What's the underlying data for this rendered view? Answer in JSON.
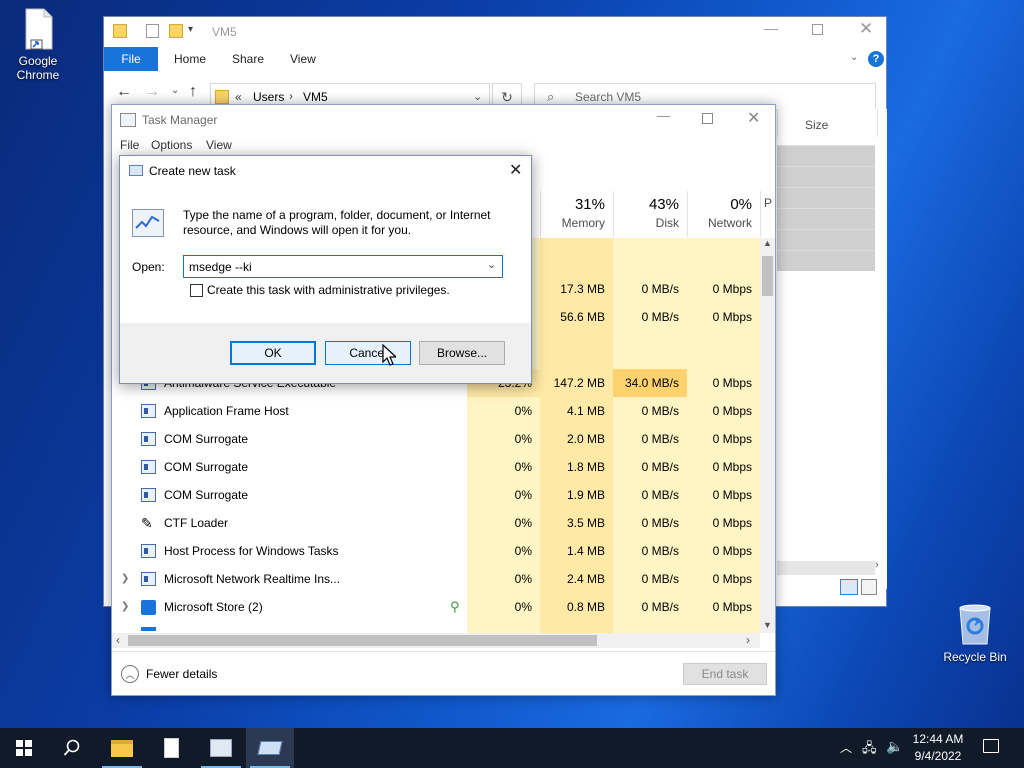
{
  "desktop": {
    "icons": [
      {
        "label": "Google Chrome"
      },
      {
        "label": "Recycle Bin"
      }
    ]
  },
  "explorer": {
    "title": "VM5",
    "ribbon_tabs": [
      "File",
      "Home",
      "Share",
      "View"
    ],
    "breadcrumb": [
      "Users",
      "VM5"
    ],
    "breadcrumb_prefix": "«",
    "search_placeholder": "Search VM5",
    "column_size": "Size"
  },
  "task_manager": {
    "title": "Task Manager",
    "menu": [
      "File",
      "Options",
      "View"
    ],
    "columns": [
      {
        "pct": "31%",
        "name": "Memory"
      },
      {
        "pct": "43%",
        "name": "Disk"
      },
      {
        "pct": "0%",
        "name": "Network"
      },
      {
        "pct": "",
        "name": "P"
      }
    ],
    "partial_rows": [
      {
        "cpu": "",
        "memory": "17.3 MB",
        "disk": "0 MB/s",
        "network": "0 Mbps"
      },
      {
        "cpu": "",
        "memory": "56.6 MB",
        "disk": "0 MB/s",
        "network": "0 Mbps"
      }
    ],
    "processes": [
      {
        "name": "Antimalware Service Executable",
        "cpu": "23.2%",
        "memory": "147.2 MB",
        "disk": "34.0 MB/s",
        "network": "0 Mbps",
        "expander": false
      },
      {
        "name": "Application Frame Host",
        "cpu": "0%",
        "memory": "4.1 MB",
        "disk": "0 MB/s",
        "network": "0 Mbps",
        "expander": false
      },
      {
        "name": "COM Surrogate",
        "cpu": "0%",
        "memory": "2.0 MB",
        "disk": "0 MB/s",
        "network": "0 Mbps",
        "expander": false
      },
      {
        "name": "COM Surrogate",
        "cpu": "0%",
        "memory": "1.8 MB",
        "disk": "0 MB/s",
        "network": "0 Mbps",
        "expander": false
      },
      {
        "name": "COM Surrogate",
        "cpu": "0%",
        "memory": "1.9 MB",
        "disk": "0 MB/s",
        "network": "0 Mbps",
        "expander": false
      },
      {
        "name": "CTF Loader",
        "cpu": "0%",
        "memory": "3.5 MB",
        "disk": "0 MB/s",
        "network": "0 Mbps",
        "expander": false
      },
      {
        "name": "Host Process for Windows Tasks",
        "cpu": "0%",
        "memory": "1.4 MB",
        "disk": "0 MB/s",
        "network": "0 Mbps",
        "expander": false
      },
      {
        "name": "Microsoft Network Realtime Ins...",
        "cpu": "0%",
        "memory": "2.4 MB",
        "disk": "0 MB/s",
        "network": "0 Mbps",
        "expander": true
      },
      {
        "name": "Microsoft Store (2)",
        "cpu": "0%",
        "memory": "0.8 MB",
        "disk": "0 MB/s",
        "network": "0 Mbps",
        "expander": true
      }
    ],
    "fewer_details": "Fewer details",
    "end_task": "End task"
  },
  "dialog": {
    "title": "Create new task",
    "description": "Type the name of a program, folder, document, or Internet resource, and Windows will open it for you.",
    "open_label": "Open:",
    "open_value": "msedge --ki",
    "admin_checkbox_label": "Create this task with administrative privileges.",
    "ok": "OK",
    "cancel": "Cancel",
    "browse": "Browse..."
  },
  "taskbar": {
    "time": "12:44 AM",
    "date": "9/4/2022"
  },
  "colors": {
    "accent": "#1a73d9",
    "heat_light": "#fff4c4",
    "heat_mid": "#ffe9a6",
    "heat_strong": "#ffd270",
    "taskbar": "#101a28"
  }
}
